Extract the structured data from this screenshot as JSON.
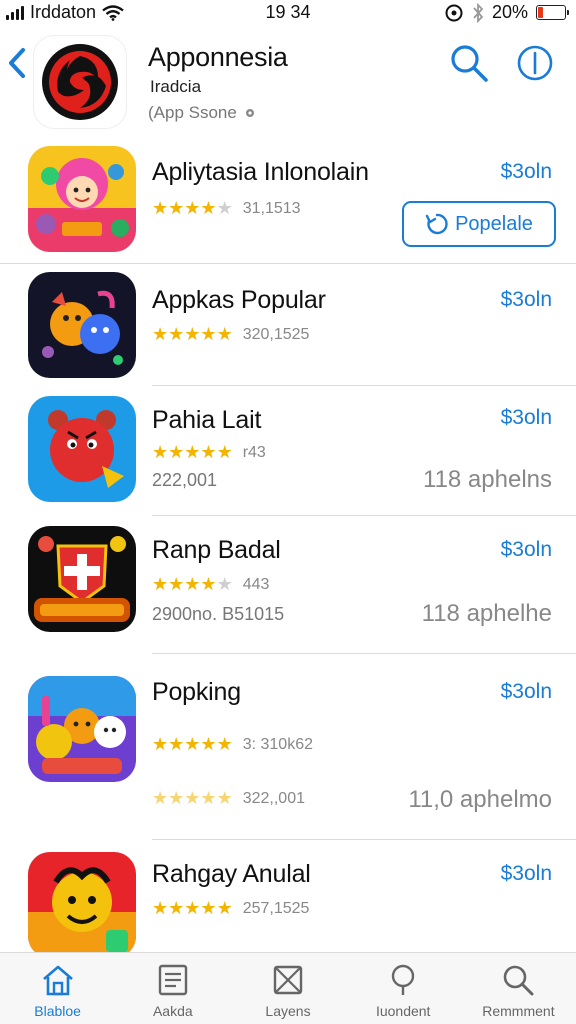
{
  "status_bar": {
    "carrier": "Irddaton",
    "time": "19 34",
    "battery": "20%",
    "battery_level": 0.2
  },
  "header": {
    "title": "Apponnesia",
    "subtitle": "Iradcia",
    "source": "(App Ssone"
  },
  "apps": [
    {
      "title": "Apliytasia Inlonolain",
      "price": "$3oln",
      "rating": 4.5,
      "rating_count": "31,1513",
      "action_label": "Popelale"
    },
    {
      "title": "Appkas Popular",
      "price": "$3oln",
      "rating": 5,
      "rating_count": "320,1525"
    },
    {
      "title": "Pahia Lait",
      "price": "$3oln",
      "rating": 5,
      "rating_count": "r43",
      "subline": "222,001",
      "right_text": "118 aphelns"
    },
    {
      "title": "Ranp Badal",
      "price": "$3oln",
      "rating": 4,
      "rating_count": "443",
      "subline": "2900no. B51015",
      "right_text": "118 aphelhe"
    },
    {
      "title": "Popking",
      "price": "$3oln",
      "rating": 5,
      "rating_count": "3:  310k62",
      "rating2": 5,
      "rating_count2": "322,,001",
      "right_text": "11,0 aphelmo"
    },
    {
      "title": "Rahgay Anulal",
      "price": "$3oln",
      "rating": 5,
      "rating_count": "257,1525"
    }
  ],
  "tabs": [
    {
      "label": "Blabloe",
      "icon": "home-icon",
      "active": true
    },
    {
      "label": "Aakda",
      "icon": "list-icon",
      "active": false
    },
    {
      "label": "Layens",
      "icon": "box-icon",
      "active": false
    },
    {
      "label": "Iuondent",
      "icon": "pin-icon",
      "active": false
    },
    {
      "label": "Remmment",
      "icon": "search-icon",
      "active": false
    }
  ],
  "colors": {
    "accent": "#1a7cd6",
    "star": "#f4b400",
    "battery_low": "#e8381b"
  }
}
